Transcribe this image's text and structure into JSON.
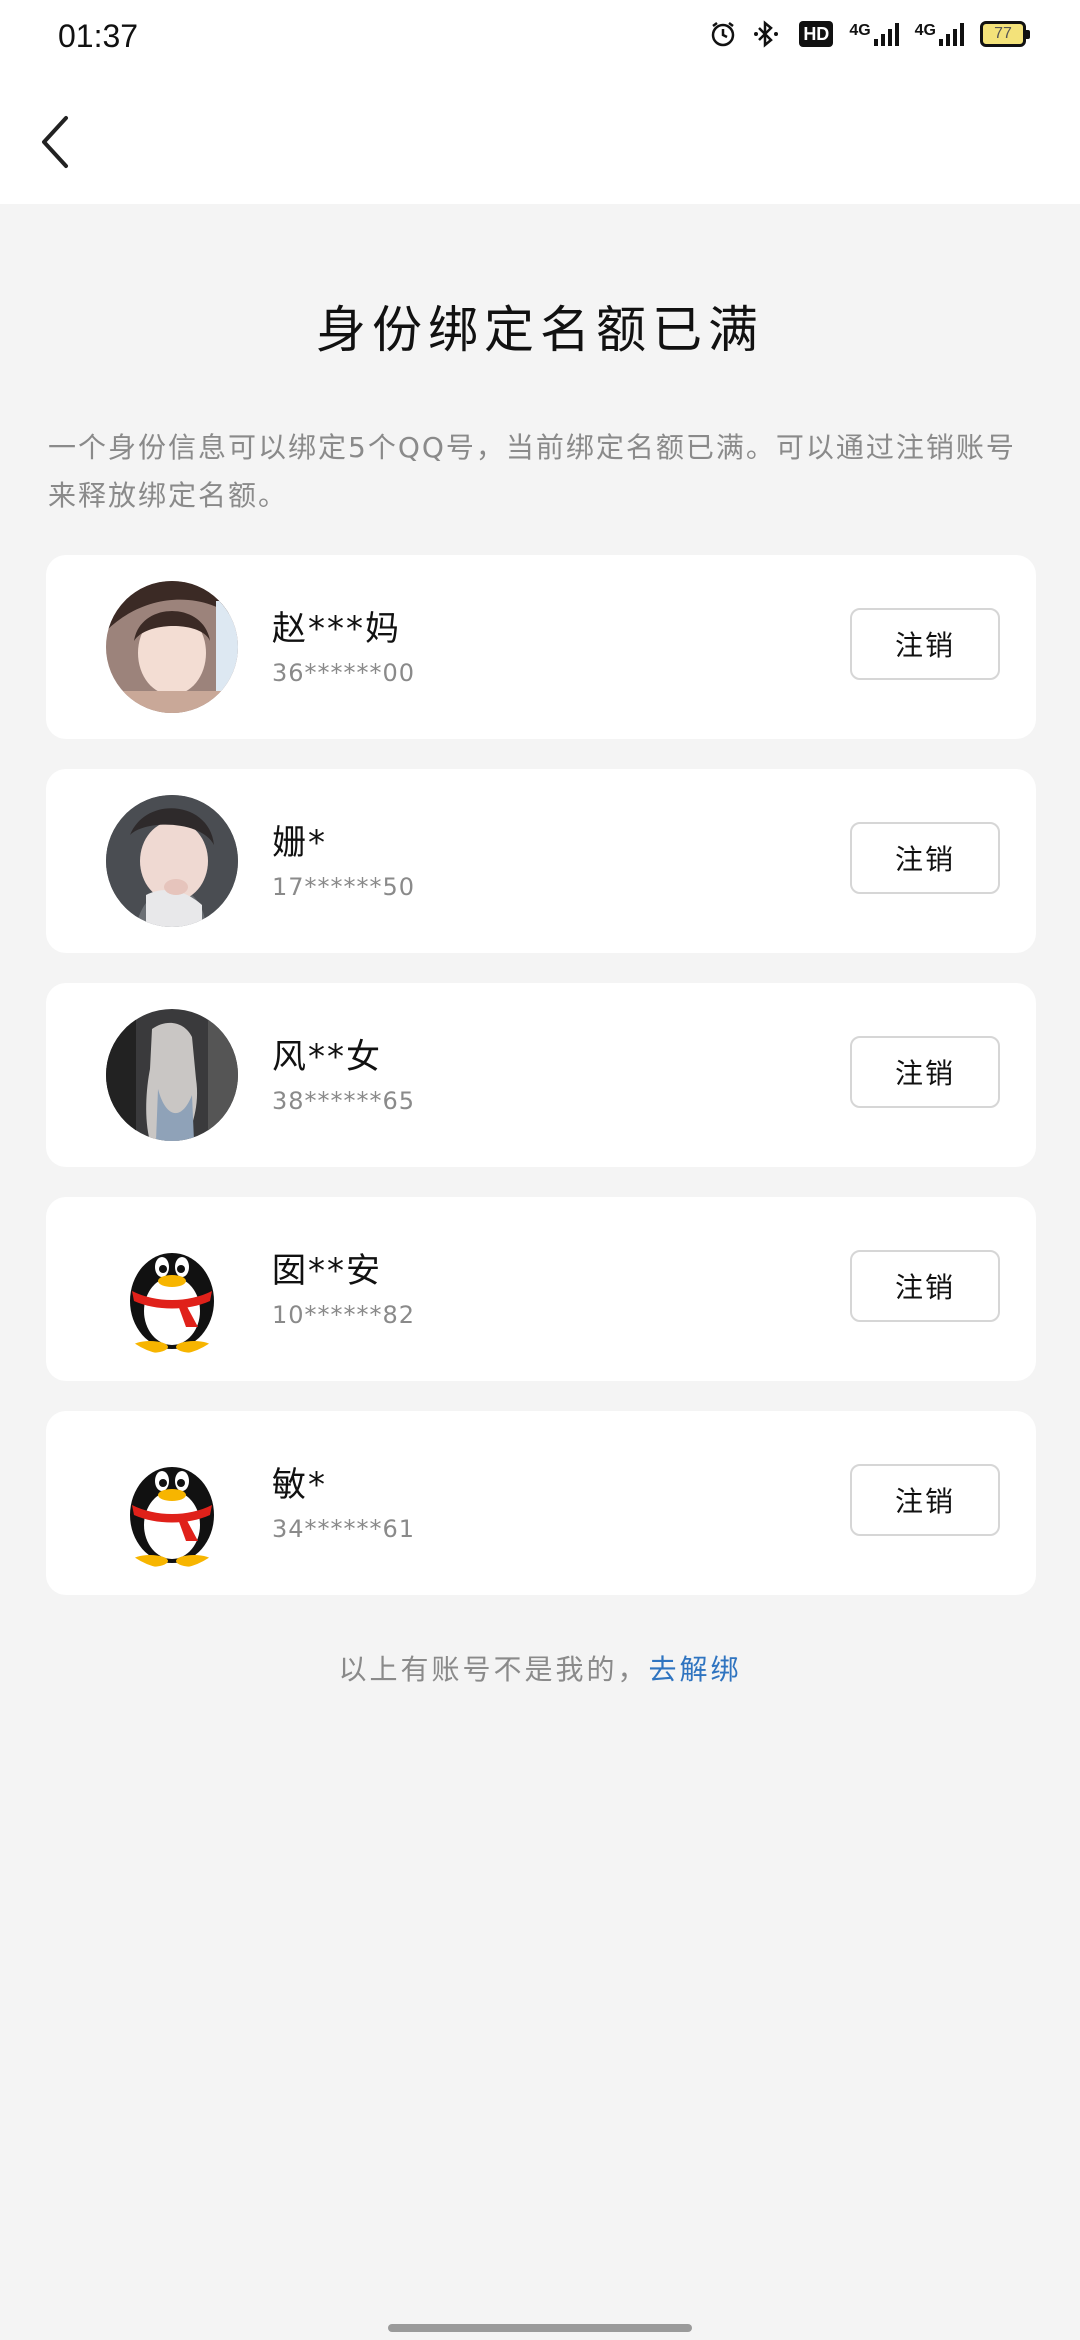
{
  "status_bar": {
    "time": "01:37",
    "hd_label": "HD",
    "net1_label": "4G",
    "net2_label": "4G",
    "battery_level": "77"
  },
  "nav": {
    "back_icon": "chevron-left-icon"
  },
  "page": {
    "title": "身份绑定名额已满",
    "description": "一个身份信息可以绑定5个QQ号，当前绑定名额已满。可以通过注销账号来释放绑定名额。"
  },
  "accounts": [
    {
      "name": "赵***妈",
      "number": "36******00",
      "action": "注销",
      "avatar": "photo-avatar"
    },
    {
      "name": "姗*",
      "number": "17******50",
      "action": "注销",
      "avatar": "photo-avatar"
    },
    {
      "name": "风**女",
      "number": "38******65",
      "action": "注销",
      "avatar": "photo-avatar"
    },
    {
      "name": "囡**安",
      "number": "10******82",
      "action": "注销",
      "avatar": "qq-penguin-icon"
    },
    {
      "name": "敏*",
      "number": "34******61",
      "action": "注销",
      "avatar": "qq-penguin-icon"
    }
  ],
  "footer": {
    "text": "以上有账号不是我的，",
    "link": "去解绑"
  },
  "colors": {
    "background": "#f4f4f4",
    "card": "#ffffff",
    "link": "#2f74c0",
    "secondary_text": "#8a8a8a"
  }
}
